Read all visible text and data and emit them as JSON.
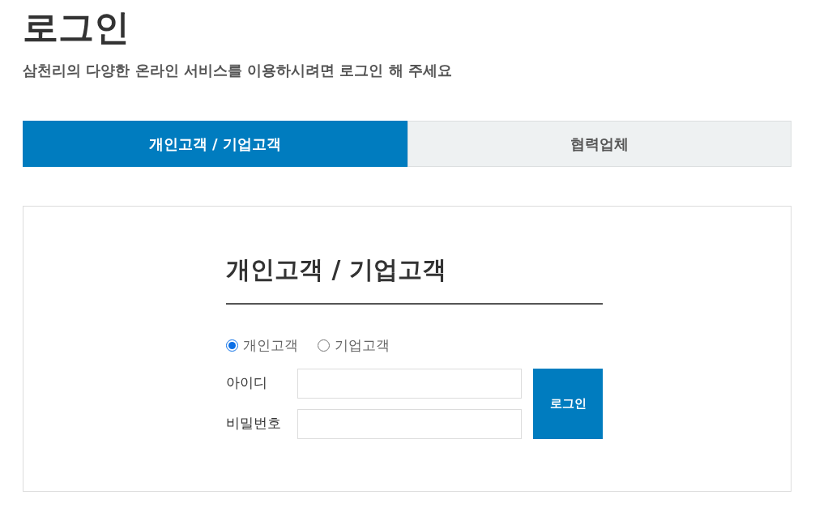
{
  "page": {
    "title": "로그인",
    "subtitle": "삼천리의 다양한 온라인 서비스를 이용하시려면 로그인 해 주세요"
  },
  "tabs": [
    {
      "label": "개인고객 / 기업고객",
      "selected": true
    },
    {
      "label": "협력업체",
      "selected": false
    }
  ],
  "login_form": {
    "heading": "개인고객 / 기업고객",
    "customer_types": [
      {
        "label": "개인고객",
        "selected": true
      },
      {
        "label": "기업고객",
        "selected": false
      }
    ],
    "fields": [
      {
        "label": "아이디"
      },
      {
        "label": "비밀번호"
      }
    ],
    "login_button": "로그인"
  }
}
